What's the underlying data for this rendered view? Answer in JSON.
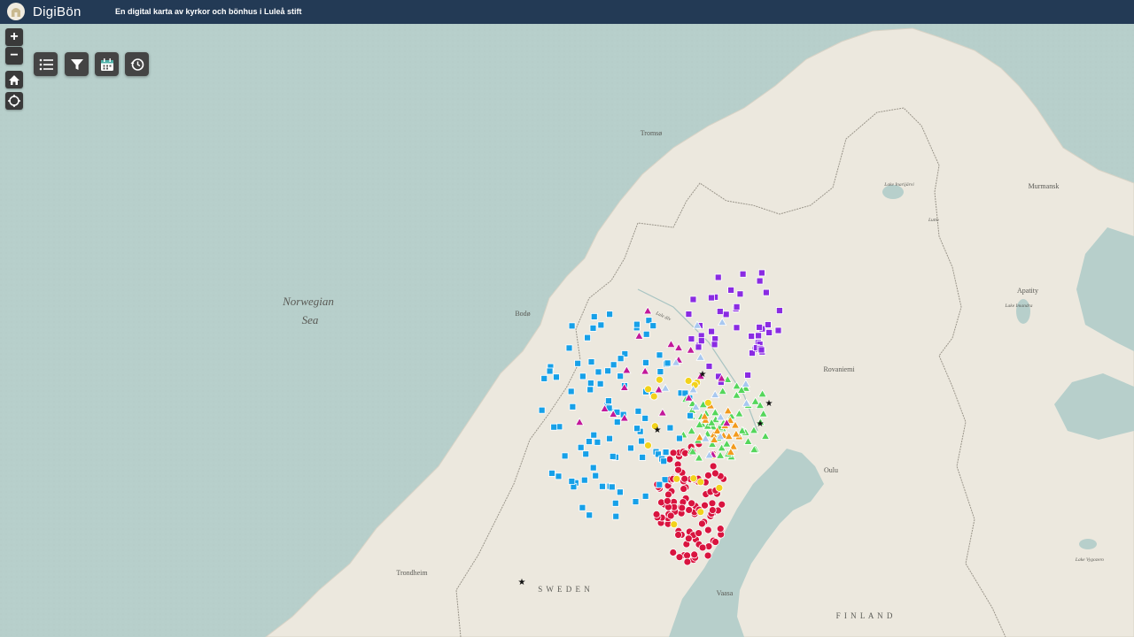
{
  "header": {
    "app_title": "DigiBön",
    "subtitle": "En digital karta av kyrkor och bönhus i Luleå stift"
  },
  "controls": {
    "zoom_in": "+",
    "zoom_out": "−"
  },
  "toolbar": {
    "icons": [
      "list-icon",
      "filter-icon",
      "calendar-icon",
      "history-icon"
    ]
  },
  "map": {
    "places": [
      "Tromsø",
      "Murmansk",
      "Bodø",
      "Apatity",
      "Rovaniemi",
      "Oulu",
      "Trondheim",
      "Vaasa"
    ],
    "countries": [
      "S W E D E N",
      "F I N L A N D"
    ],
    "sea": {
      "line1": "Norwegian",
      "line2": "Sea"
    },
    "water": [
      "Lake Inarijärvi",
      "Lake Imandra",
      "Lake Vygozero"
    ],
    "rivers": [
      "Lule älv",
      "Lutto"
    ]
  },
  "colors": {
    "sea": "#b7cfcb",
    "land": "#ece8de",
    "header": "#233a55",
    "marker_red": "#d9143f",
    "marker_blue": "#16a0e8",
    "marker_purple": "#8a2be2",
    "marker_green": "#55d65b",
    "marker_orange": "#f29a1d",
    "marker_yellow": "#f2d21b",
    "marker_magenta": "#c2189a",
    "marker_lightblue": "#a8c8f0"
  }
}
